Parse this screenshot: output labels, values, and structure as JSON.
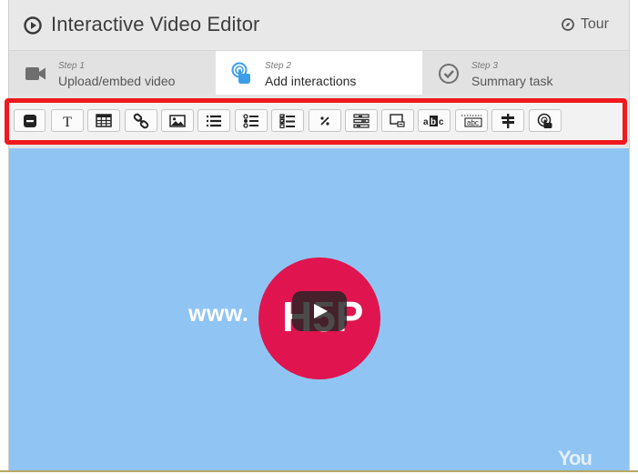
{
  "header": {
    "title": "Interactive Video Editor",
    "tour_label": "Tour"
  },
  "steps": [
    {
      "number": "Step 1",
      "label": "Upload/embed video",
      "icon": "video-camera-icon",
      "active": false
    },
    {
      "number": "Step 2",
      "label": "Add interactions",
      "icon": "touch-hand-icon",
      "active": true
    },
    {
      "number": "Step 3",
      "label": "Summary task",
      "icon": "check-circle-icon",
      "active": false
    }
  ],
  "toolbar": {
    "highlight_color": "#f0191e",
    "buttons": [
      "label-icon",
      "text-icon",
      "table-icon",
      "link-icon",
      "image-icon",
      "statements-icon",
      "single-choice-icon",
      "multiple-choice-icon",
      "fill-blanks-icon",
      "drag-question-icon",
      "crossroads-icon",
      "mark-words-icon",
      "drag-text-icon",
      "navigation-hotspot-icon",
      "goto-icon"
    ]
  },
  "video": {
    "url_fragment": "www.",
    "overlay_brand": "H5P",
    "provider": "YouTube",
    "background_color": "#90c4f2",
    "accent_color": "#e0144f"
  }
}
